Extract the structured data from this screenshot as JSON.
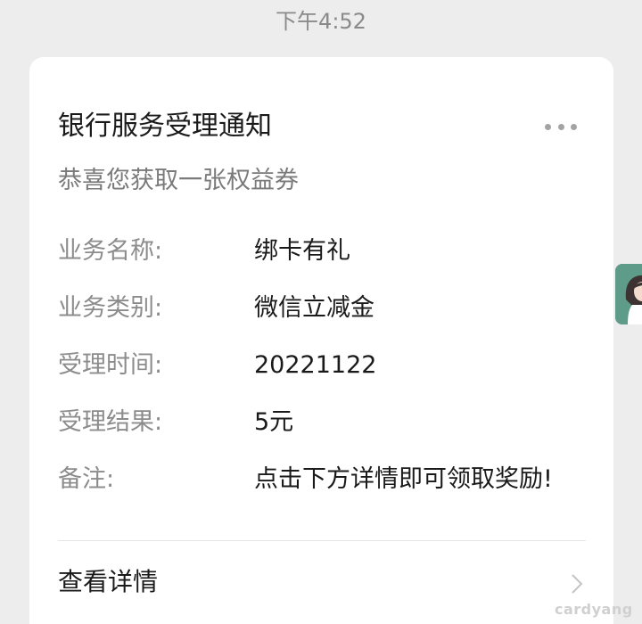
{
  "chat": {
    "timestamp": "下午4:52"
  },
  "card": {
    "title": "银行服务受理通知",
    "subtitle": "恭喜您获取一张权益券",
    "more_icon": "more-horizontal-icon",
    "fields": [
      {
        "label": "业务名称:",
        "value": "绑卡有礼"
      },
      {
        "label": "业务类别:",
        "value": "微信立减金"
      },
      {
        "label": "受理时间:",
        "value": "20221122"
      },
      {
        "label": "受理结果:",
        "value": "5元"
      },
      {
        "label": "备注:",
        "value": "点击下方详情即可领取奖励!"
      }
    ],
    "details_label": "查看详情",
    "details_icon": "chevron-right-icon"
  },
  "avatar": {
    "icon": "avatar-icon"
  },
  "watermark": "cardyang",
  "colors": {
    "page_background": "#ededed",
    "card_background": "#ffffff",
    "avatar_background": "#5e9b88"
  }
}
